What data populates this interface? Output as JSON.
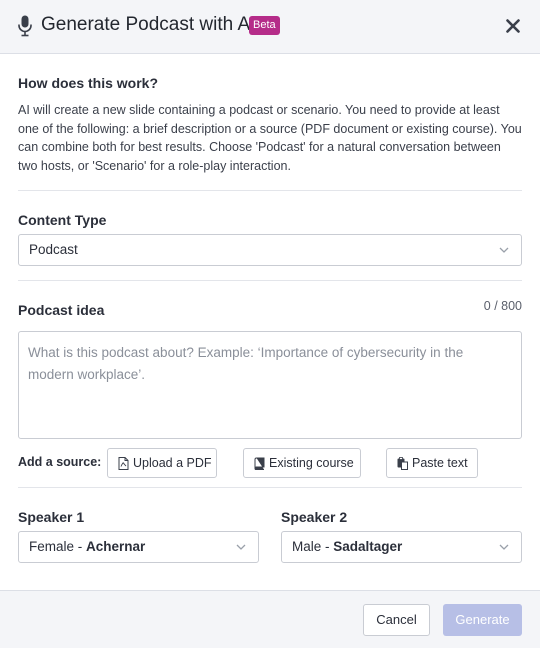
{
  "header": {
    "title": "Generate Podcast with AI",
    "badge": "Beta",
    "icons": {
      "mic": "microphone-icon",
      "close": "close-icon"
    }
  },
  "help": {
    "title": "How does this work?",
    "text": "AI will create a new slide containing a podcast or scenario. You need to provide at least one of the following: a brief description or a source (PDF document or existing course). You can combine both for best results. Choose 'Podcast' for a natural conversation between two hosts, or 'Scenario' for a role-play interaction."
  },
  "content_type": {
    "label": "Content Type",
    "selected": "Podcast"
  },
  "idea": {
    "label": "Podcast idea",
    "counter": "0 / 800",
    "value": "",
    "placeholder": "What is this podcast about? Example: ‘Importance of cybersecurity in the modern workplace’."
  },
  "sources": {
    "label": "Add a source:",
    "buttons": [
      {
        "label": "Upload a PDF",
        "icon": "pdf-file-icon"
      },
      {
        "label": "Existing course",
        "icon": "book-icon"
      },
      {
        "label": "Paste text",
        "icon": "clipboard-icon"
      }
    ]
  },
  "speakers": [
    {
      "label": "Speaker 1",
      "gender": "Female",
      "separator": " - ",
      "voice": "Achernar"
    },
    {
      "label": "Speaker 2",
      "gender": "Male",
      "separator": " - ",
      "voice": "Sadaltager"
    }
  ],
  "footer": {
    "cancel_label": "Cancel",
    "generate_label": "Generate"
  },
  "colors": {
    "beta_badge": "#b52c89",
    "generate_disabled": "#b7bfe6",
    "header_bg": "#f4f5f8"
  }
}
